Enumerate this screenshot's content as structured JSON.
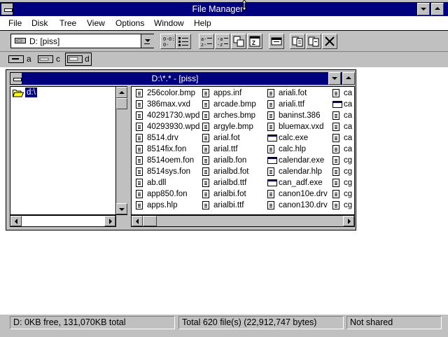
{
  "app": {
    "title": "File Manager"
  },
  "menu": [
    "File",
    "Disk",
    "Tree",
    "View",
    "Options",
    "Window",
    "Help"
  ],
  "drive_combo": {
    "value": "D: [piss]"
  },
  "drives": [
    {
      "letter": "a",
      "icon": "floppy-drive-icon"
    },
    {
      "letter": "c",
      "icon": "hard-drive-icon"
    },
    {
      "letter": "d",
      "icon": "network-drive-icon"
    }
  ],
  "child_window": {
    "title": "D:\\*.* - [piss]"
  },
  "tree": {
    "root": "d:\\"
  },
  "files": [
    [
      "256color.bmp",
      "386max.vxd",
      "40291730.wpd",
      "40293930.wpd",
      "8514.drv",
      "8514fix.fon",
      "8514oem.fon",
      "8514sys.fon",
      "ab.dll",
      "app850.fon",
      "apps.hlp"
    ],
    [
      "apps.inf",
      "arcade.bmp",
      "arches.bmp",
      "argyle.bmp",
      "arial.fot",
      "arial.ttf",
      "arialb.fon",
      "arialbd.fot",
      "arialbd.ttf",
      "arialbi.fot",
      "arialbi.ttf"
    ],
    [
      "ariali.fot",
      "ariali.ttf",
      "baninst.386",
      "bluemax.vxd",
      "calc.exe",
      "calc.hlp",
      "calendar.exe",
      "calendar.hlp",
      "can_adf.exe",
      "canon10e.drv",
      "canon130.drv"
    ],
    [
      "ca",
      "ca",
      "ca",
      "ca",
      "ca",
      "ca",
      "cg",
      "cg",
      "cg",
      "cg",
      "cg"
    ]
  ],
  "file_types": [
    [
      "doc",
      "doc",
      "doc",
      "doc",
      "doc",
      "doc",
      "doc",
      "doc",
      "doc",
      "doc",
      "doc"
    ],
    [
      "doc",
      "doc",
      "doc",
      "doc",
      "doc",
      "doc",
      "doc",
      "doc",
      "doc",
      "doc",
      "doc"
    ],
    [
      "doc",
      "doc",
      "doc",
      "doc",
      "exe",
      "doc",
      "exe",
      "doc",
      "exe",
      "doc",
      "doc"
    ],
    [
      "doc",
      "exe",
      "doc",
      "doc",
      "doc",
      "doc",
      "doc",
      "doc",
      "doc",
      "doc",
      "doc"
    ]
  ],
  "status": {
    "free": "D: 0KB free,  131,070KB total",
    "total": "Total 620 file(s) (22,912,747 bytes)",
    "share": "Not shared"
  }
}
